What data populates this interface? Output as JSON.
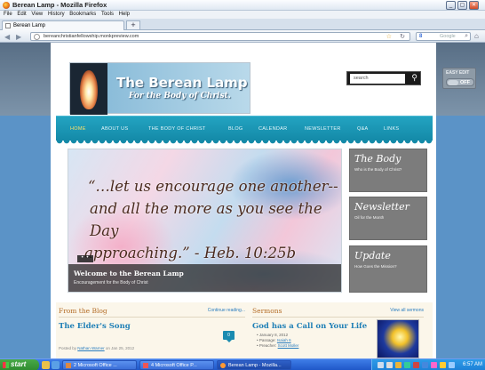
{
  "window": {
    "title": "Berean Lamp - Mozilla Firefox"
  },
  "menu": [
    "File",
    "Edit",
    "View",
    "History",
    "Bookmarks",
    "Tools",
    "Help"
  ],
  "tab": {
    "label": "Berean Lamp",
    "newtab": "+"
  },
  "navbar": {
    "url": "bereanchristianfellowship.monkpreview.com",
    "search_engine": "Google"
  },
  "site": {
    "logo_title": "The Berean Lamp",
    "logo_subtitle": "For the Body of Christ.",
    "search_placeholder": "search",
    "easy_edit_label": "EASY EDIT",
    "easy_edit_state": "OFF",
    "nav": [
      "HOME",
      "ABOUT US",
      "THE BODY OF CHRIST",
      "BLOG",
      "CALENDAR",
      "NEWSLETTER",
      "Q&A",
      "LINKS"
    ],
    "hero": {
      "line1": "“…let us encourage one another--",
      "line2": "and all the more as you see the Day",
      "line3": "approaching.” - Heb. 10:25b",
      "caption_title": "Welcome to the Berean Lamp",
      "caption_subtitle": "Encouragement for the Body of Christ",
      "slider_dots": "• •"
    },
    "side_boxes": [
      {
        "title": "The Body",
        "subtitle": "Who is the Body of Christ?"
      },
      {
        "title": "Newsletter",
        "subtitle": "Oil for the Month"
      },
      {
        "title": "Update",
        "subtitle": "How Goes the Mission?"
      }
    ],
    "blog": {
      "heading": "From the Blog",
      "link": "Continue reading...",
      "post_title": "The Elder's Song",
      "meta_prefix": "Posted by",
      "author": "Nathan Warner",
      "meta_date": "on Jan 25, 2012",
      "comments": "0"
    },
    "sermons": {
      "heading": "Sermons",
      "link": "View all sermons",
      "title": "God has a Call on Your Life",
      "date": "January 8, 2012",
      "passage_label": "Passage:",
      "passage": "Isaiah 6",
      "preacher_label": "Preacher:",
      "preacher": "Scott Moller"
    }
  },
  "taskbar": {
    "start": "start",
    "buttons": [
      "2 Microsoft Office ...",
      "4 Microsoft Office P...",
      "Berean Lamp - Mozilla..."
    ],
    "clock": "6:57 AM"
  }
}
